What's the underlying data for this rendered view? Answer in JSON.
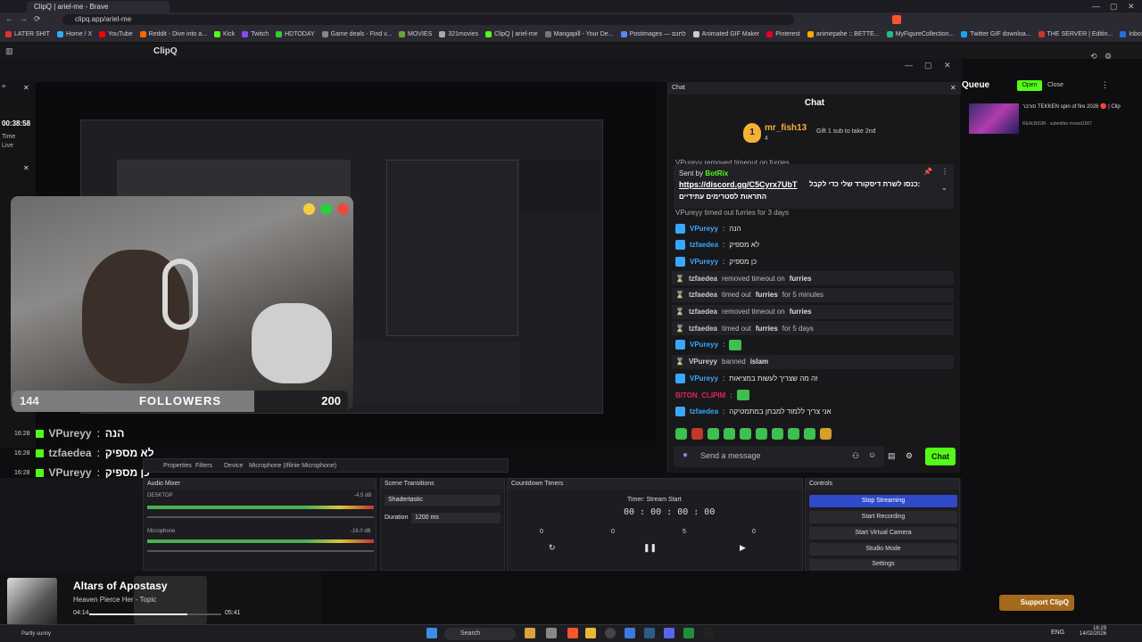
{
  "browser": {
    "tab_title": "ClipQ | ariel-me - Brave",
    "url": "clipq.app/ariel-me",
    "bookmarks": [
      "LATER SHIT",
      "Home / X",
      "YouTube",
      "Reddit - Dive into a...",
      "Kick",
      "Twitch",
      "HDTODAY",
      "Game deals - Find v...",
      "MOVIES",
      "321movies",
      "ClipQ | ariel-me",
      "Mangapill - Your De...",
      "Postimages — לחנם",
      "Animated GIF Maker",
      "Pinterest",
      "animepahe :: BETTE...",
      "MyFigureCollection...",
      "Twitter GIF downloa...",
      "THE SERVER | Editin...",
      "Inbox (252) - ariel..."
    ]
  },
  "app": {
    "title": "ClipQ"
  },
  "left": {
    "clock": "00:38:58",
    "time_label": "Time",
    "live_label": "Live"
  },
  "followers": {
    "current": "144",
    "label": "FOLLOWERS",
    "goal": "200",
    "fraction": 0.72
  },
  "overlay_chat": [
    {
      "time": "16:28",
      "user": "VPureyy",
      "msg": "הנה"
    },
    {
      "time": "16:28",
      "user": "tzfaedea",
      "msg": "לא מספיק"
    },
    {
      "time": "16:28",
      "user": "VPureyy",
      "msg": "כן מספיק"
    },
    {
      "time": "16:28",
      "user": "VPureyy",
      "msg": ""
    },
    {
      "time": "16:29",
      "user": "VPureyy",
      "msg": "זה מה שצריך לעשות במציאות"
    },
    {
      "time": "16:29",
      "user": "BITON_CLIPIM",
      "msg": ""
    },
    {
      "time": "16:29",
      "user": "tzfaedea",
      "msg": "אני צריך ללמוד למבחן במתמטיקה"
    }
  ],
  "obs": {
    "properties": "Properties",
    "filters": "Filters",
    "device": "Device",
    "mic": "Microphone (Ifilnie Microphone)",
    "audio_mixer": "Audio Mixer",
    "desktop": "DESKTOP",
    "desktop_db": "-4.5 dB",
    "microphone": "Microphone",
    "mic_db": "-16.0 dB",
    "scene_transitions": "Scene Transitions",
    "transition": "Shadertastic",
    "duration_label": "Duration",
    "duration": "1200 ms",
    "countdown": "Countdown Timers",
    "timer_name": "Timer: Stream Start",
    "timer_display": "00 : 00 : 00 : 00",
    "timer_fields": [
      "0",
      "0",
      "5",
      "0"
    ],
    "controls": "Controls",
    "buttons": [
      "Stop Streaming",
      "Start Recording",
      "Start Virtual Camera",
      "Studio Mode",
      "Settings"
    ]
  },
  "media": {
    "title": "Altars of Apostasy",
    "artist": "Heaven Pierce Her - Topic",
    "elapsed": "04:14",
    "duration": "05:41",
    "progress": 0.74
  },
  "chat": {
    "panel_label": "Chat",
    "title": "Chat",
    "top_gifter": {
      "rank": "1",
      "name": "mr_fish13",
      "count": "4"
    },
    "gift_text": "Gift 1 sub to take 2nd",
    "pinned": {
      "sent_by_label": "Sent by",
      "sent_by": "BotRix",
      "link": "https://discord.gg/C5Cyrx7UbT",
      "link_rest": "כנסו לשרת דיסקורד שלי כדי לקבל:",
      "line2": "התראות לסטרימים עתידיים"
    },
    "partial_top": "VPureyy removed timeout on furries",
    "partial_second": "VPureyy timed out furries for 3 days",
    "lines": [
      {
        "kind": "msg",
        "user": "VPureyy",
        "color": "#3aa7ff",
        "text": "הנה"
      },
      {
        "kind": "msg",
        "user": "tzfaedea",
        "color": "#3aa7ff",
        "text": "לא מספיק"
      },
      {
        "kind": "msg",
        "user": "VPureyy",
        "color": "#3aa7ff",
        "text": "כן מספיק"
      },
      {
        "kind": "mod",
        "user": "tzfaedea",
        "action": "removed timeout on",
        "target": "furries"
      },
      {
        "kind": "mod",
        "user": "tzfaedea",
        "action": "timed out",
        "target": "furries",
        "extra": "for 5 minutes"
      },
      {
        "kind": "mod",
        "user": "tzfaedea",
        "action": "removed timeout on",
        "target": "furries"
      },
      {
        "kind": "mod",
        "user": "tzfaedea",
        "action": "timed out",
        "target": "furries",
        "extra": "for 5 days"
      },
      {
        "kind": "msg",
        "user": "VPureyy",
        "color": "#3aa7ff",
        "text": ""
      },
      {
        "kind": "mod",
        "user": "VPureyy",
        "action": "banned",
        "target": "islam"
      },
      {
        "kind": "msg",
        "user": "VPureyy",
        "color": "#3aa7ff",
        "text": "זה מה שצריך לעשות במציאות"
      },
      {
        "kind": "msg",
        "user": "BITON_CLIPIM",
        "color": "#e0245e",
        "text": ""
      },
      {
        "kind": "msg",
        "user": "tzfaedea",
        "color": "#3aa7ff",
        "text": "אני צריך ללמוד למבחן במתמטיקה"
      }
    ],
    "input_placeholder": "Send a message",
    "send_label": "Chat"
  },
  "queue": {
    "title": "Queue",
    "open_label": "Open",
    "close_label": "Close",
    "item_title": "סורבר TEKKEN spin of fire 2026 🔴 | Clip",
    "item_meta": "REALBIGBI · submitter mrood1007"
  },
  "support_label": "Support ClipQ",
  "taskbar": {
    "weather": "Partly sunny",
    "search": "Search",
    "lang": "ENG",
    "time": "16:29",
    "date": "14/02/2026"
  }
}
